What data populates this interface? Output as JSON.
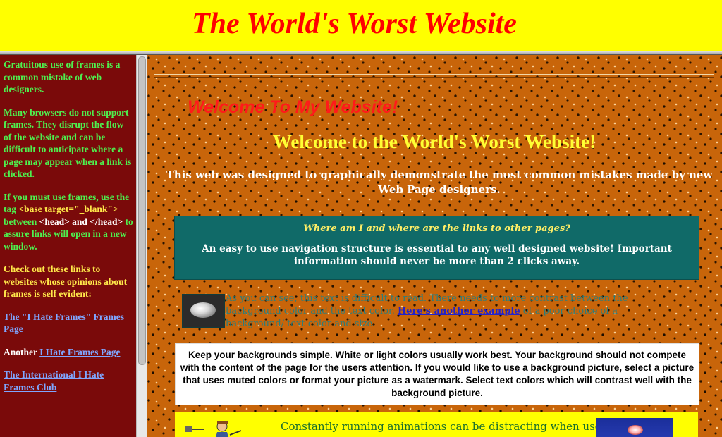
{
  "header": {
    "title": "The World's Worst Website"
  },
  "left_frame": {
    "p1": "Gratuitous use of frames is a common mistake of web designers.",
    "p2": "Many browsers do not support frames. They disrupt the flow of the website and can be difficult to anticipate where a page may appear when a link is clicked.",
    "p3_before": "If you must use frames, use the tag",
    "p3_tag": "<base target=\"_blank\">",
    "p3_between": "between",
    "p3_head": "<head> and </head>",
    "p3_after": "to assure links will open in a new window.",
    "p4": "Check out these links to websites whose opinions about frames is self evident:",
    "link1": "The \"I Hate Frames\" Frames Page",
    "link2_prefix": "Another",
    "link2": "I Hate Frames Page",
    "link3": "The International I Hate Frames Club"
  },
  "main": {
    "welcome_red": "Welcome To My Website!",
    "welcome_yellow": "Welcome to the World's Worst Website!",
    "intro": "This web was designed to graphically demonstrate the most common mistakes made by new Web Page designers.",
    "nav_question": "Where am I and where are the links to other pages?",
    "nav_text": "An easy to use navigation structure is essential to any well designed website! Important information should never be more than 2 clicks away.",
    "poor_text_before": "As you can see, this text is difficult to read. There needs to more contrast between the background color and the text color.",
    "poor_link": "Here's another example",
    "poor_text_after": "of a poor choice of a background/ text color and size.",
    "bg_advice": "Keep your backgrounds simple. White or light colors usually work best. Your background should not compete with the content of the page for the users attention. If you would like to use a background picture, select a picture that uses muted colors or format your picture as a watermark. Select text colors which will contrast well with the background picture.",
    "animation_text": "Constantly running animations can be distracting when used"
  },
  "colors": {
    "top_bg": "#ffff00",
    "title": "#ff0000",
    "left_bg": "#7a0a0a",
    "main_bg": "#c8650a",
    "teal_box": "#106a68"
  }
}
